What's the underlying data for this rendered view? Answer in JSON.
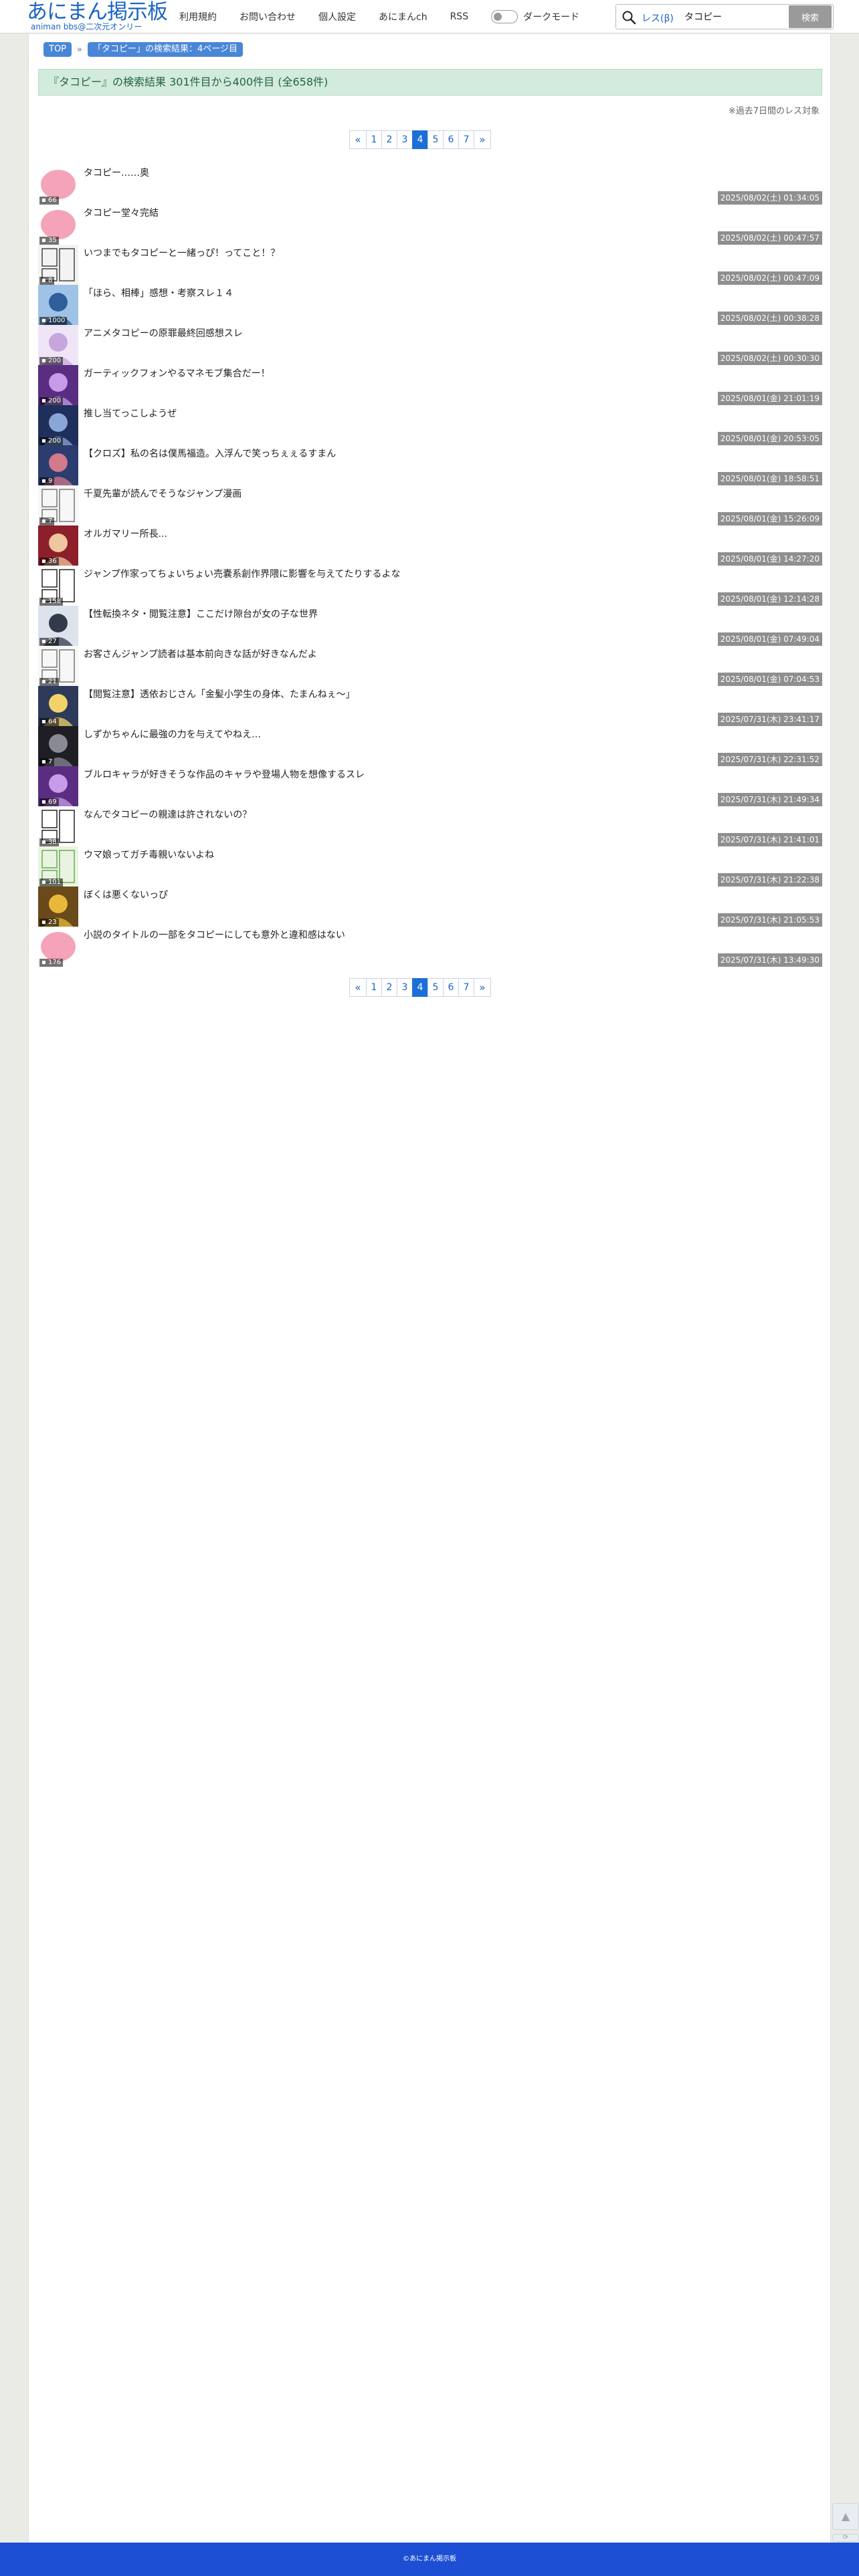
{
  "header": {
    "logo_main": "あにまん掲示板",
    "logo_sub": "animan bbs@二次元オンリー",
    "nav": [
      "利用規約",
      "お問い合わせ",
      "個人設定",
      "あにまんch",
      "RSS"
    ],
    "dark_mode_label": "ダークモード",
    "search_scope": "レス(β)",
    "search_value": "タコピー",
    "search_button": "検索"
  },
  "breadcrumb": {
    "top": "TOP",
    "current": "「タコピー」の検索結果：4ページ目"
  },
  "result_banner": "『タコピー』の検索結果 301件目から400件目 (全658件)",
  "note": "※過去7日間のレス対象",
  "pagination": {
    "prev": "«",
    "pages": [
      "1",
      "2",
      "3",
      "4",
      "5",
      "6",
      "7"
    ],
    "current": "4",
    "next": "»"
  },
  "threads": [
    {
      "title": "タコピー……奥",
      "count": "66",
      "date": "2025/08/02(土) 01:34:05",
      "thumb": "pink"
    },
    {
      "title": "タコピー堂々完結",
      "count": "35",
      "date": "2025/08/02(土) 00:47:57",
      "thumb": "pink"
    },
    {
      "title": "いつまでもタコピーと一緒っぴ！ってこと！？",
      "count": "8",
      "date": "2025/08/02(土) 00:47:09",
      "thumb": "manga"
    },
    {
      "title": "「ほら、相棒」感想・考察スレ１４",
      "count": "1000",
      "date": "2025/08/02(土) 00:38:28",
      "thumb": "blue"
    },
    {
      "title": "アニメタコピーの原罪最終回感想スレ",
      "count": "200",
      "date": "2025/08/02(土) 00:30:30",
      "thumb": "lilac"
    },
    {
      "title": "ガーティックフォンやるマネモブ集合だー！",
      "count": "200",
      "date": "2025/08/01(金) 21:01:19",
      "thumb": "purple"
    },
    {
      "title": "推し当てっこしようぜ",
      "count": "200",
      "date": "2025/08/01(金) 20:53:05",
      "thumb": "darkblue"
    },
    {
      "title": "【クロズ】私の名は僕馬福造。入浮んで笑っちぇぇるすまん",
      "count": "9",
      "date": "2025/08/01(金) 18:58:51",
      "thumb": "navy"
    },
    {
      "title": "千夏先輩が読んでそうなジャンプ漫画",
      "count": "7",
      "date": "2025/08/01(金) 15:26:09",
      "thumb": "sketch"
    },
    {
      "title": "オルガマリー所長...",
      "count": "36",
      "date": "2025/08/01(金) 14:27:20",
      "thumb": "red"
    },
    {
      "title": "ジャンプ作家ってちょいちょい売嚢系創作界隈に影響を与えてたりするよな",
      "count": "158",
      "date": "2025/08/01(金) 12:14:28",
      "thumb": "bw"
    },
    {
      "title": "【性転換ネタ・閲覧注意】ここだけ隙台が女の子な世界",
      "count": "27",
      "date": "2025/08/01(金) 07:49:04",
      "thumb": "girl"
    },
    {
      "title": "お客さんジャンプ読者は基本前向きな話が好きなんだよ",
      "count": "21",
      "date": "2025/08/01(金) 07:04:53",
      "thumb": "sketch"
    },
    {
      "title": "【閲覧注意】透依おじさん「金髪小学生の身体、たまんねぇ〜」",
      "count": "64",
      "date": "2025/07/31(木) 23:41:17",
      "thumb": "blonde"
    },
    {
      "title": "しずかちゃんに最強の力を与えてやねえ…",
      "count": "7",
      "date": "2025/07/31(木) 22:31:52",
      "thumb": "dark"
    },
    {
      "title": "ブルロキャラが好きそうな作品のキャラや登場人物を想像するスレ",
      "count": "69",
      "date": "2025/07/31(木) 21:49:34",
      "thumb": "purple"
    },
    {
      "title": "なんでタコピーの親達は許されないの？",
      "count": "38",
      "date": "2025/07/31(木) 21:41:01",
      "thumb": "bw"
    },
    {
      "title": "ウマ娘ってガチ毒親いないよね",
      "count": "101",
      "date": "2025/07/31(木) 21:22:38",
      "thumb": "green"
    },
    {
      "title": "ぼくは悪くないっぴ",
      "count": "23",
      "date": "2025/07/31(木) 21:05:53",
      "thumb": "gold"
    },
    {
      "title": "小説のタイトルの一部をタコピーにしても意外と違和感はない",
      "count": "176",
      "date": "2025/07/31(木) 13:49:30",
      "thumb": "pink"
    }
  ],
  "footer": "©あにまん掲示板",
  "colors": {
    "brand": "#1b64c4",
    "banner": "#d2ebdc",
    "date_badge": "#8f8f8f",
    "footer": "#1d4fd4"
  }
}
